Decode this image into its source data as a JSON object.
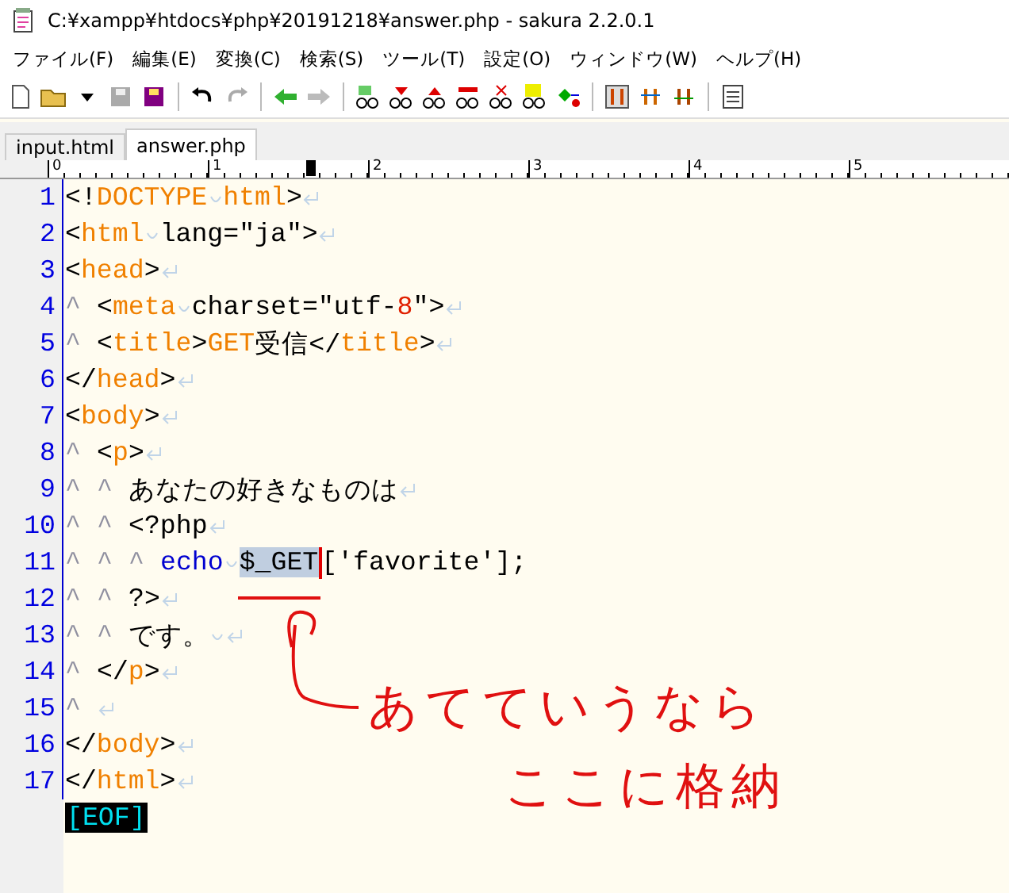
{
  "window": {
    "title": "C:¥xampp¥htdocs¥php¥20191218¥answer.php - sakura 2.2.0.1"
  },
  "menu": [
    "ファイル(F)",
    "編集(E)",
    "変換(C)",
    "検索(S)",
    "ツール(T)",
    "設定(O)",
    "ウィンドウ(W)",
    "ヘルプ(H)"
  ],
  "tabs": [
    {
      "label": "input.html",
      "selected": false
    },
    {
      "label": "answer.php",
      "selected": true
    }
  ],
  "ruler": {
    "labels": [
      "0",
      "1",
      "2",
      "3",
      "4",
      "5"
    ]
  },
  "editor": {
    "lines": [
      {
        "number": "1",
        "eol": true,
        "tokens": [
          {
            "kind": "mark",
            "text": "<!"
          },
          {
            "kind": "tag",
            "text": "DOCTYPE"
          },
          {
            "kind": "space"
          },
          {
            "kind": "tag",
            "text": "html"
          },
          {
            "kind": "mark",
            "text": ">"
          }
        ]
      },
      {
        "number": "2",
        "eol": true,
        "tokens": [
          {
            "kind": "mark",
            "text": "<"
          },
          {
            "kind": "tag",
            "text": "html"
          },
          {
            "kind": "space"
          },
          {
            "kind": "mark",
            "text": "lang=\"ja\">"
          }
        ]
      },
      {
        "number": "3",
        "eol": true,
        "tokens": [
          {
            "kind": "mark",
            "text": "<"
          },
          {
            "kind": "tag",
            "text": "head"
          },
          {
            "kind": "mark",
            "text": ">"
          }
        ]
      },
      {
        "number": "4",
        "eol": true,
        "tokens": [
          {
            "kind": "tab",
            "text": "^"
          },
          {
            "kind": "mark",
            "text": "<"
          },
          {
            "kind": "tag",
            "text": "meta"
          },
          {
            "kind": "space"
          },
          {
            "kind": "mark",
            "text": "charset=\"utf-"
          },
          {
            "kind": "number",
            "text": "8"
          },
          {
            "kind": "mark",
            "text": "\">"
          }
        ]
      },
      {
        "number": "5",
        "eol": true,
        "tokens": [
          {
            "kind": "tab",
            "text": "^"
          },
          {
            "kind": "mark",
            "text": "<"
          },
          {
            "kind": "tag",
            "text": "title"
          },
          {
            "kind": "mark",
            "text": ">"
          },
          {
            "kind": "tag",
            "text": "GET"
          },
          {
            "kind": "mark",
            "text": "受信</"
          },
          {
            "kind": "tag",
            "text": "title"
          },
          {
            "kind": "mark",
            "text": ">"
          }
        ]
      },
      {
        "number": "6",
        "eol": true,
        "tokens": [
          {
            "kind": "mark",
            "text": "</"
          },
          {
            "kind": "tag",
            "text": "head"
          },
          {
            "kind": "mark",
            "text": ">"
          }
        ]
      },
      {
        "number": "7",
        "eol": true,
        "tokens": [
          {
            "kind": "mark",
            "text": "<"
          },
          {
            "kind": "tag",
            "text": "body"
          },
          {
            "kind": "mark",
            "text": ">"
          }
        ]
      },
      {
        "number": "8",
        "eol": true,
        "tokens": [
          {
            "kind": "tab",
            "text": "^"
          },
          {
            "kind": "mark",
            "text": "<"
          },
          {
            "kind": "tag",
            "text": "p"
          },
          {
            "kind": "mark",
            "text": ">"
          }
        ]
      },
      {
        "number": "9",
        "eol": true,
        "tokens": [
          {
            "kind": "tab",
            "text": "^"
          },
          {
            "kind": "tab",
            "text": "^"
          },
          {
            "kind": "mark",
            "text": "あなたの好きなものは"
          }
        ]
      },
      {
        "number": "10",
        "eol": true,
        "tokens": [
          {
            "kind": "tab",
            "text": "^"
          },
          {
            "kind": "tab",
            "text": "^"
          },
          {
            "kind": "mark",
            "text": "<?php"
          }
        ]
      },
      {
        "number": "11",
        "eol": false,
        "tokens": [
          {
            "kind": "tab",
            "text": "^"
          },
          {
            "kind": "tab",
            "text": "^"
          },
          {
            "kind": "tab",
            "text": "^"
          },
          {
            "kind": "keyword",
            "text": "echo"
          },
          {
            "kind": "space"
          },
          {
            "kind": "selection",
            "text": "$_GET"
          },
          {
            "kind": "mark",
            "text": "['favorite'];"
          }
        ]
      },
      {
        "number": "12",
        "eol": true,
        "tokens": [
          {
            "kind": "tab",
            "text": "^"
          },
          {
            "kind": "tab",
            "text": "^"
          },
          {
            "kind": "mark",
            "text": "?>"
          }
        ]
      },
      {
        "number": "13",
        "eol": true,
        "tokens": [
          {
            "kind": "tab",
            "text": "^"
          },
          {
            "kind": "tab",
            "text": "^"
          },
          {
            "kind": "mark",
            "text": "です。"
          },
          {
            "kind": "space"
          }
        ]
      },
      {
        "number": "14",
        "eol": true,
        "tokens": [
          {
            "kind": "tab",
            "text": "^"
          },
          {
            "kind": "mark",
            "text": "</"
          },
          {
            "kind": "tag",
            "text": "p"
          },
          {
            "kind": "mark",
            "text": ">"
          }
        ]
      },
      {
        "number": "15",
        "eol": true,
        "tokens": [
          {
            "kind": "tab",
            "text": "^"
          }
        ]
      },
      {
        "number": "16",
        "eol": true,
        "tokens": [
          {
            "kind": "mark",
            "text": "</"
          },
          {
            "kind": "tag",
            "text": "body"
          },
          {
            "kind": "mark",
            "text": ">"
          }
        ]
      },
      {
        "number": "17",
        "eol": true,
        "tokens": [
          {
            "kind": "mark",
            "text": "</"
          },
          {
            "kind": "tag",
            "text": "html"
          },
          {
            "kind": "mark",
            "text": ">"
          }
        ]
      }
    ],
    "eof": "[EOF]"
  },
  "annotation": {
    "lines": [
      "あてていうなら",
      "ここに格納"
    ]
  }
}
